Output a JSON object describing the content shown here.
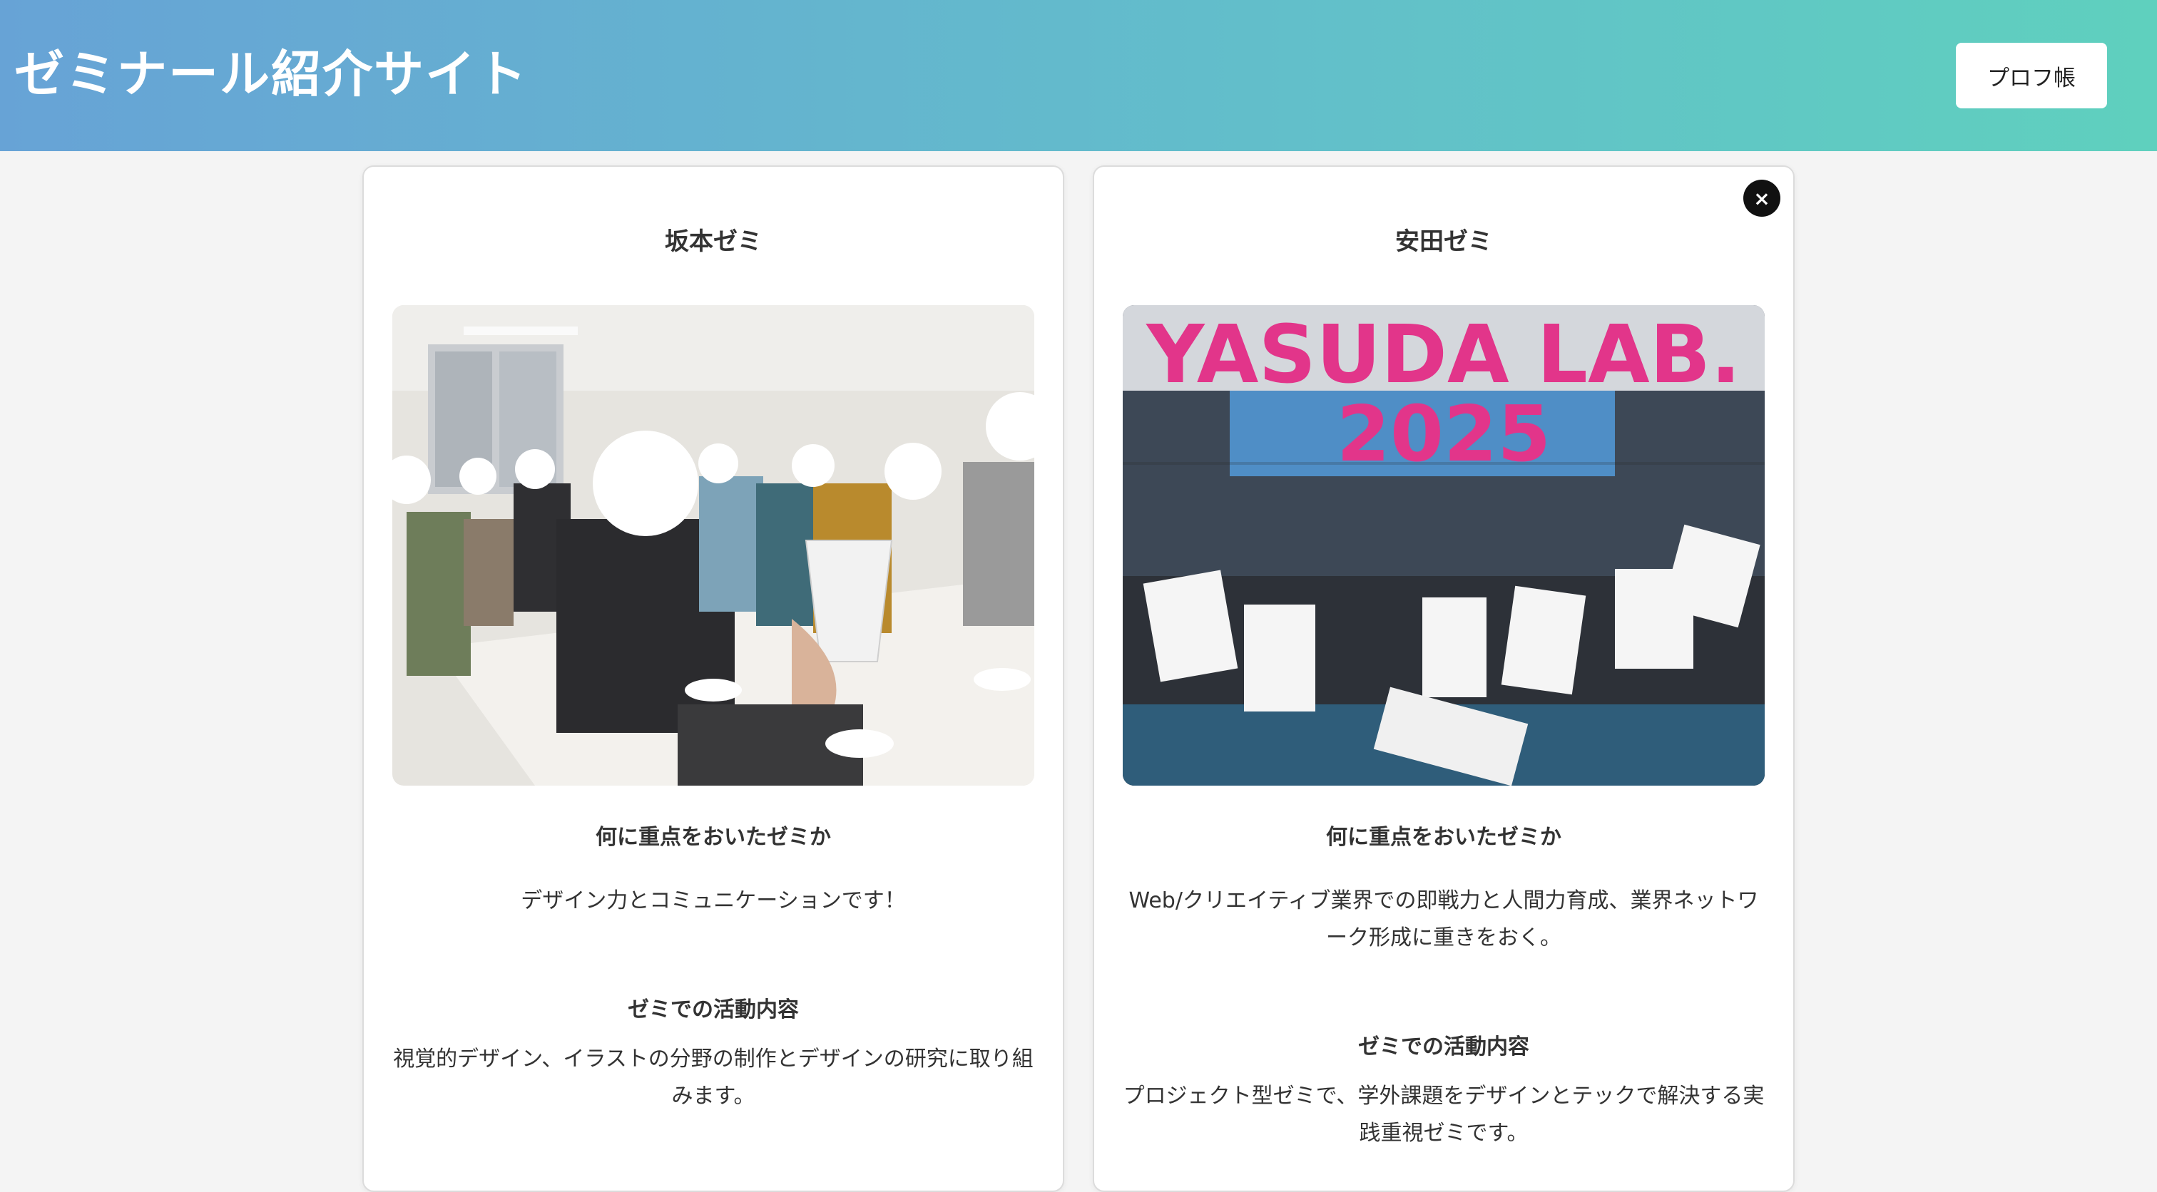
{
  "header": {
    "title": "ゼミナール紹介サイト",
    "profile_button_label": "プロフ帳"
  },
  "colors": {
    "header_gradient_start": "#67a3d6",
    "header_gradient_end": "#5fd0be",
    "card_background": "#ffffff",
    "page_background": "#f4f4f4"
  },
  "cards": [
    {
      "title": "坂本ゼミ",
      "image_description": "group-photo",
      "focus_label": "何に重点をおいたゼミか",
      "focus_text": "デザイン力とコミュニケーションです！",
      "activity_label": "ゼミでの活動内容",
      "activity_text": "視覚的デザイン、イラストの分野の制作とデザインの研究に取り組みます。"
    },
    {
      "title": "安田ゼミ",
      "banner_text": "YASUDA LAB.",
      "banner_year": "2025",
      "focus_label": "何に重点をおいたゼミか",
      "focus_text": "Web/クリエイティブ業界での即戦力と人間力育成、業界ネットワーク形成に重きをおく。",
      "activity_label": "ゼミでの活動内容",
      "activity_text": "プロジェクト型ゼミで、学外課題をデザインとテックで解決する実践重視ゼミです。",
      "close_icon": "×"
    }
  ]
}
